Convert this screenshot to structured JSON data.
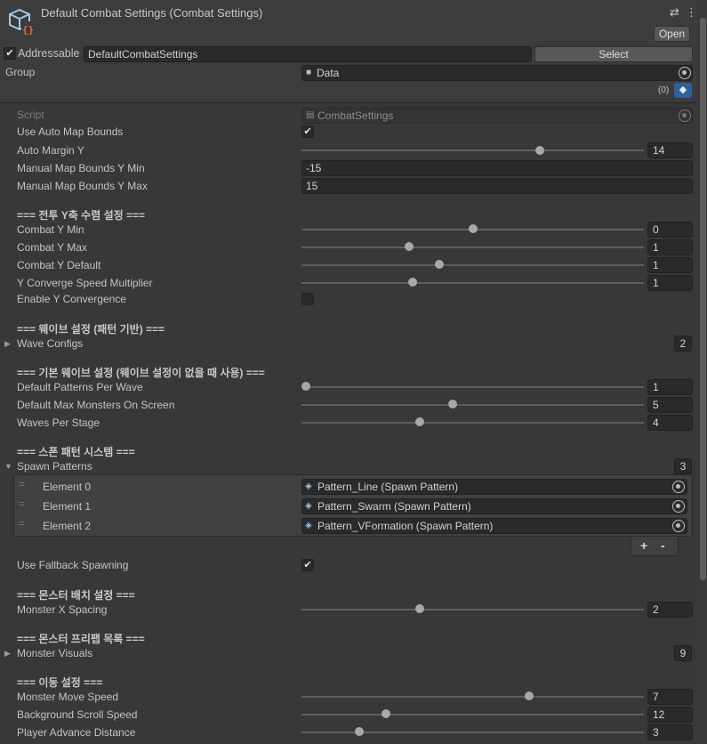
{
  "header": {
    "title": "Default Combat Settings (Combat Settings)",
    "open_label": "Open",
    "icons": [
      "settings-sliders-icon",
      "kebab-menu-icon"
    ]
  },
  "addressable": {
    "checked": true,
    "label": "Addressable",
    "address": "DefaultCombatSettings",
    "select_label": "Select",
    "group_label": "Group",
    "group_value": "Data",
    "labels_count": "(0)"
  },
  "script": {
    "label": "Script",
    "value": "CombatSettings"
  },
  "fields": {
    "use_auto_map_bounds": {
      "label": "Use Auto Map Bounds",
      "checked": true
    },
    "auto_margin_y": {
      "label": "Auto Margin Y",
      "value": "14",
      "fraction": 0.7
    },
    "manual_min": {
      "label": "Manual Map Bounds Y Min",
      "value": "-15"
    },
    "manual_max": {
      "label": "Manual Map Bounds Y Max",
      "value": "15"
    },
    "h_combat": "=== 전투 Y축 수렴 설정 ===",
    "combat_y_min": {
      "label": "Combat Y Min",
      "value": "0",
      "fraction": 0.5
    },
    "combat_y_max": {
      "label": "Combat Y Max",
      "value": "1",
      "fraction": 0.31
    },
    "combat_y_default": {
      "label": "Combat Y Default",
      "value": "1",
      "fraction": 0.4
    },
    "y_speed": {
      "label": "Y Converge Speed Multiplier",
      "value": "1",
      "fraction": 0.32
    },
    "enable_y": {
      "label": "Enable Y Convergence",
      "checked": false
    },
    "h_wave": "=== 웨이브 설정 (패턴 기반) ===",
    "wave_configs": {
      "label": "Wave Configs",
      "count": "2"
    },
    "h_default_wave": "=== 기본 웨이브 설정 (웨이브 설정이 없을 때 사용) ===",
    "patterns_per_wave": {
      "label": "Default Patterns Per Wave",
      "value": "1",
      "fraction": 0.0
    },
    "max_monsters": {
      "label": "Default Max Monsters On Screen",
      "value": "5",
      "fraction": 0.44
    },
    "waves_per_stage": {
      "label": "Waves Per Stage",
      "value": "4",
      "fraction": 0.34
    },
    "h_spawn": "=== 스폰 패턴 시스템 ===",
    "spawn_patterns": {
      "label": "Spawn Patterns",
      "count": "3",
      "elements": [
        {
          "label": "Element 0",
          "value": "Pattern_Line (Spawn Pattern)"
        },
        {
          "label": "Element 1",
          "value": "Pattern_Swarm (Spawn Pattern)"
        },
        {
          "label": "Element 2",
          "value": "Pattern_VFormation (Spawn Pattern)"
        }
      ],
      "add_label": "+",
      "remove_label": "-"
    },
    "fallback": {
      "label": "Use Fallback Spawning",
      "checked": true
    },
    "h_monster": "=== 몬스터 배치 설정 ===",
    "monster_x_spacing": {
      "label": "Monster X Spacing",
      "value": "2",
      "fraction": 0.34
    },
    "h_prefab": "=== 몬스터 프리팹 목록 ===",
    "monster_visuals": {
      "label": "Monster Visuals",
      "count": "9"
    },
    "h_move": "=== 이동 설정 ===",
    "move_speed": {
      "label": "Monster Move Speed",
      "value": "7",
      "fraction": 0.67
    },
    "bg_scroll": {
      "label": "Background Scroll Speed",
      "value": "12",
      "fraction": 0.24
    },
    "player_adv": {
      "label": "Player Advance Distance",
      "value": "3",
      "fraction": 0.16
    }
  },
  "colors": {
    "background": "#383838",
    "field": "#2a2a2a",
    "label_icon": "#2f5f9e"
  }
}
